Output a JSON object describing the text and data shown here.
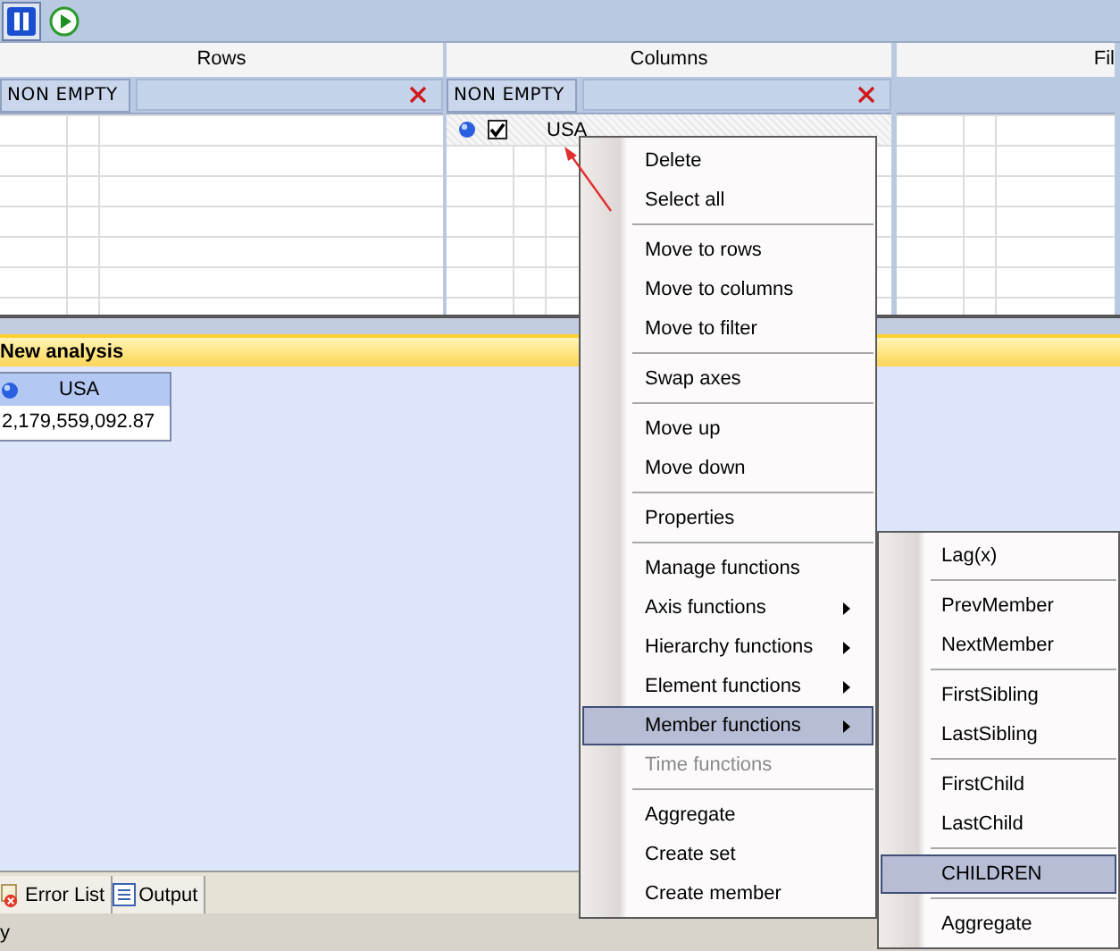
{
  "toolbar_buttons": [
    {
      "kind": "pause",
      "selected": true
    },
    {
      "kind": "run",
      "selected": false
    }
  ],
  "axes": [
    {
      "title": "Rows",
      "modifier": "NON EMPTY"
    },
    {
      "title": "Columns",
      "modifier": "NON EMPTY",
      "members": [
        {
          "name": "USA",
          "checked": true
        }
      ]
    },
    {
      "title": "Fil"
    }
  ],
  "analysis": {
    "title": "New analysis",
    "table": {
      "column": "USA",
      "value": "2,179,559,092.87"
    }
  },
  "bottom_tabs": [
    {
      "label": "Error List",
      "kind": "errors"
    },
    {
      "label": "Output",
      "kind": "output"
    }
  ],
  "status_bar": {
    "text": "y"
  },
  "context_menu": {
    "items": [
      {
        "kind": "item",
        "label": "Delete",
        "selected": false,
        "disabled": false,
        "submenu": false
      },
      {
        "kind": "item",
        "label": "Select all",
        "selected": false,
        "disabled": false,
        "submenu": false
      },
      {
        "kind": "separator"
      },
      {
        "kind": "item",
        "label": "Move to rows",
        "selected": false,
        "disabled": false,
        "submenu": false
      },
      {
        "kind": "item",
        "label": "Move to columns",
        "selected": false,
        "disabled": false,
        "submenu": false
      },
      {
        "kind": "item",
        "label": "Move to filter",
        "selected": false,
        "disabled": false,
        "submenu": false
      },
      {
        "kind": "separator"
      },
      {
        "kind": "item",
        "label": "Swap axes",
        "selected": false,
        "disabled": false,
        "submenu": false
      },
      {
        "kind": "separator"
      },
      {
        "kind": "item",
        "label": "Move up",
        "selected": false,
        "disabled": false,
        "submenu": false
      },
      {
        "kind": "item",
        "label": "Move down",
        "selected": false,
        "disabled": false,
        "submenu": false
      },
      {
        "kind": "separator"
      },
      {
        "kind": "item",
        "label": "Properties",
        "selected": false,
        "disabled": false,
        "submenu": false
      },
      {
        "kind": "separator"
      },
      {
        "kind": "item",
        "label": "Manage functions",
        "selected": false,
        "disabled": false,
        "submenu": false
      },
      {
        "kind": "item",
        "label": "Axis functions",
        "selected": false,
        "disabled": false,
        "submenu": true
      },
      {
        "kind": "item",
        "label": "Hierarchy functions",
        "selected": false,
        "disabled": false,
        "submenu": true
      },
      {
        "kind": "item",
        "label": "Element functions",
        "selected": false,
        "disabled": false,
        "submenu": true
      },
      {
        "kind": "item",
        "label": "Member functions",
        "selected": true,
        "disabled": false,
        "submenu": true
      },
      {
        "kind": "item",
        "label": "Time functions",
        "selected": false,
        "disabled": true,
        "submenu": false
      },
      {
        "kind": "separator"
      },
      {
        "kind": "item",
        "label": "Aggregate",
        "selected": false,
        "disabled": false,
        "submenu": false
      },
      {
        "kind": "item",
        "label": "Create set",
        "selected": false,
        "disabled": false,
        "submenu": false
      },
      {
        "kind": "item",
        "label": "Create member",
        "selected": false,
        "disabled": false,
        "submenu": false
      }
    ]
  },
  "submenu": {
    "items": [
      {
        "kind": "item",
        "label": "Lag(x)",
        "selected": false
      },
      {
        "kind": "separator"
      },
      {
        "kind": "item",
        "label": "PrevMember",
        "selected": false
      },
      {
        "kind": "item",
        "label": "NextMember",
        "selected": false
      },
      {
        "kind": "separator"
      },
      {
        "kind": "item",
        "label": "FirstSibling",
        "selected": false
      },
      {
        "kind": "item",
        "label": "LastSibling",
        "selected": false
      },
      {
        "kind": "separator"
      },
      {
        "kind": "item",
        "label": "FirstChild",
        "selected": false
      },
      {
        "kind": "item",
        "label": "LastChild",
        "selected": false
      },
      {
        "kind": "separator"
      },
      {
        "kind": "item",
        "label": "CHILDREN",
        "selected": true
      },
      {
        "kind": "separator"
      },
      {
        "kind": "item",
        "label": "Aggregate",
        "selected": false
      }
    ]
  }
}
